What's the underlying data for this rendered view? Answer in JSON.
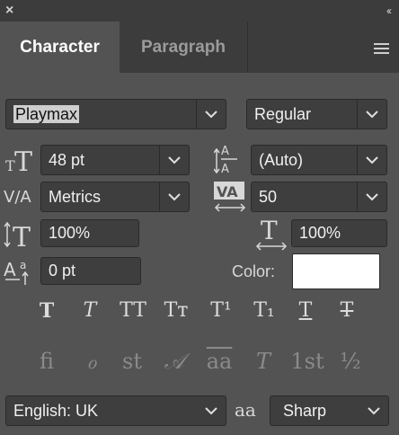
{
  "panel": {
    "close_glyph": "×",
    "collapse_glyph": "‹‹",
    "menu_icon": "hamburger-icon"
  },
  "tabs": [
    {
      "label": "Character"
    },
    {
      "label": "Paragraph"
    }
  ],
  "font": {
    "family": "Playmax",
    "style": "Regular"
  },
  "fields": {
    "font_size": "48 pt",
    "leading": "(Auto)",
    "kerning": "Metrics",
    "tracking": "50",
    "vertical_scale": "100%",
    "horizontal_scale": "100%",
    "baseline_shift": "0 pt",
    "color_label": "Color:",
    "color_value": "#ffffff"
  },
  "type_buttons": [
    {
      "name": "faux-bold",
      "glyph": "T"
    },
    {
      "name": "faux-italic",
      "glyph": "T"
    },
    {
      "name": "all-caps",
      "glyph": "TT"
    },
    {
      "name": "small-caps",
      "glyph": "Tт"
    },
    {
      "name": "superscript",
      "glyph": "T¹"
    },
    {
      "name": "subscript",
      "glyph": "T₁"
    },
    {
      "name": "underline",
      "glyph": "T"
    },
    {
      "name": "strikethrough",
      "glyph": "T"
    }
  ],
  "opentype_buttons": [
    {
      "name": "ligatures",
      "glyph": "fi"
    },
    {
      "name": "alternate-ligatures",
      "glyph": "ℴ"
    },
    {
      "name": "discretionary-ligatures",
      "glyph": "st"
    },
    {
      "name": "swash",
      "glyph": "𝒜"
    },
    {
      "name": "stylistic-alternates",
      "glyph": "aa"
    },
    {
      "name": "titling-alternates",
      "glyph": "T"
    },
    {
      "name": "ordinals",
      "glyph": "1st"
    },
    {
      "name": "fractions",
      "glyph": "½"
    }
  ],
  "language": "English: UK",
  "antialias_glyph": "aa",
  "antialias": "Sharp"
}
